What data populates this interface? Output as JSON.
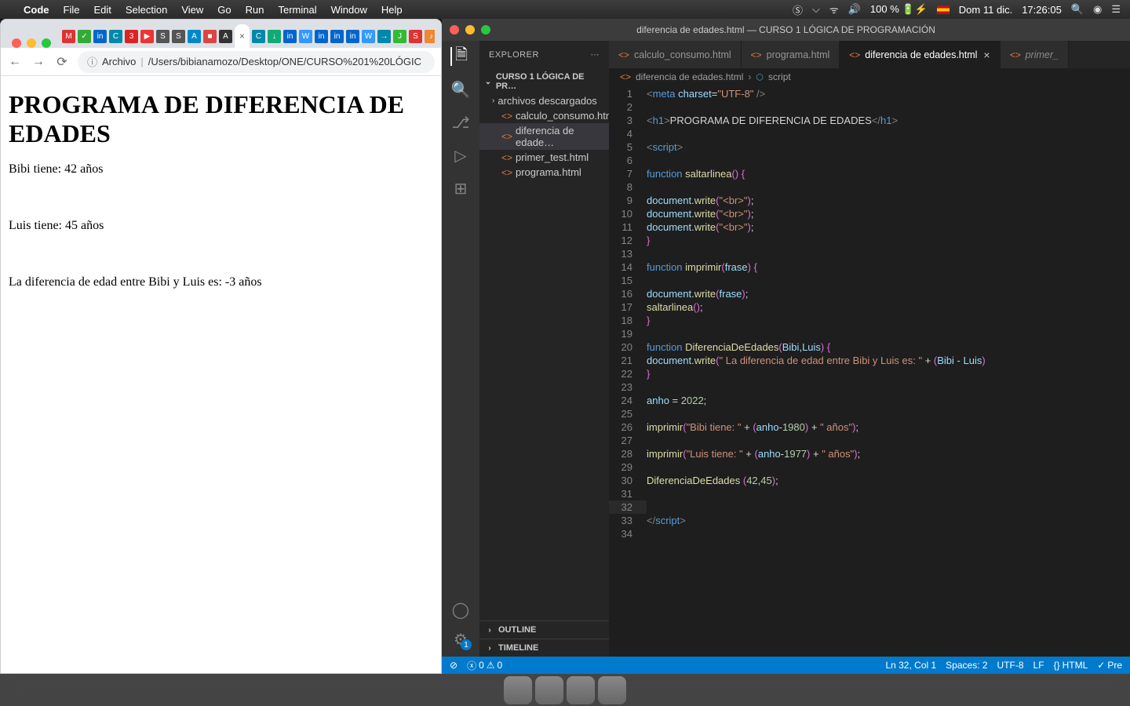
{
  "menubar": {
    "app": "Code",
    "items": [
      "File",
      "Edit",
      "Selection",
      "View",
      "Go",
      "Run",
      "Terminal",
      "Window",
      "Help"
    ],
    "battery": "100 %",
    "date": "Dom 11 dic.",
    "time": "17:26:05"
  },
  "browser": {
    "addr_proto": "Archivo",
    "addr_path": "/Users/bibianamozo/Desktop/ONE/CURSO%201%20LÓGIC",
    "content": {
      "h1": "PROGRAMA DE DIFERENCIA DE EDADES",
      "l1": "Bibi tiene: 42 años",
      "l2": "Luis tiene: 45 años",
      "l3": "La diferencia de edad entre Bibi y Luis es: -3 años"
    }
  },
  "vscode": {
    "window_title": "diferencia de edades.html — CURSO 1 LÓGICA DE PROGRAMACIÓN",
    "explorer_title": "EXPLORER",
    "project": "CURSO 1 LÓGICA DE PR…",
    "tree": {
      "folder_archivos": "archivos descargados",
      "f_calculo": "calculo_consumo.html",
      "f_dif": "diferencia de edade…",
      "f_primer": "primer_test.html",
      "f_prog": "programa.html"
    },
    "outline": "OUTLINE",
    "timeline": "TIMELINE",
    "tabs": {
      "t1": "calculo_consumo.html",
      "t2": "programa.html",
      "t3": "diferencia de edades.html",
      "t4": "primer_"
    },
    "breadcrumb": {
      "file": "diferencia de edades.html",
      "sym": "script"
    },
    "status": {
      "errors": "0",
      "warns": "0",
      "ln": "Ln 32, Col 1",
      "spaces": "Spaces: 2",
      "enc": "UTF-8",
      "eol": "LF",
      "lang": "HTML",
      "prettier": "Pre"
    },
    "settings_badge": "1"
  }
}
